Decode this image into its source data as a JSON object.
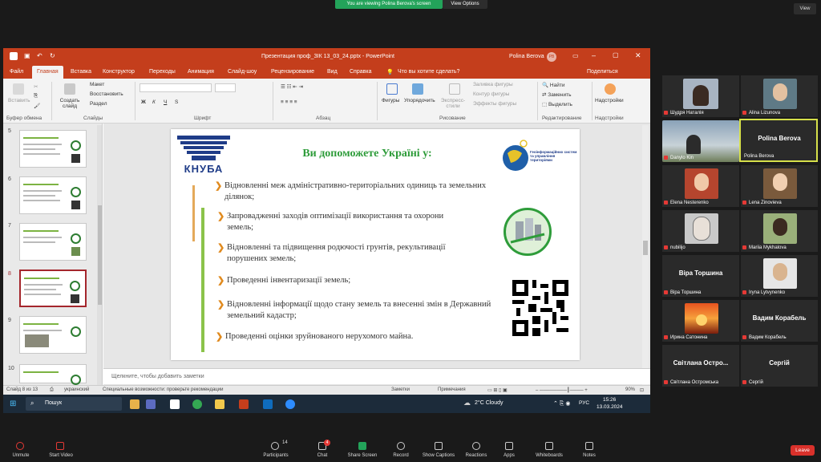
{
  "zoom": {
    "banner": "You are viewing Polina Berova's screen",
    "view_options": "View Options",
    "view": "View",
    "leave": "Leave",
    "participants_count": "14",
    "chat_badge": "4",
    "toolbar": [
      {
        "label": "Unmute",
        "icon": "mic-muted-icon"
      },
      {
        "label": "Start Video",
        "icon": "video-off-icon"
      },
      {
        "label": "Participants",
        "icon": "participants-icon"
      },
      {
        "label": "Chat",
        "icon": "chat-icon"
      },
      {
        "label": "Share Screen",
        "icon": "share-screen-icon"
      },
      {
        "label": "Record",
        "icon": "record-icon"
      },
      {
        "label": "Show Captions",
        "icon": "captions-icon"
      },
      {
        "label": "Reactions",
        "icon": "reactions-icon"
      },
      {
        "label": "Apps",
        "icon": "apps-icon"
      },
      {
        "label": "Whiteboards",
        "icon": "whiteboards-icon"
      },
      {
        "label": "Notes",
        "icon": "notes-icon"
      }
    ],
    "gallery": [
      {
        "name": "Шудря Наталія",
        "big": ""
      },
      {
        "name": "Alina Lizunova",
        "big": ""
      },
      {
        "name": "Danylo Kin",
        "big": ""
      },
      {
        "name": "Polina Berova",
        "big": "Polina Berova"
      },
      {
        "name": "Elena Nesterenko",
        "big": ""
      },
      {
        "name": "Lena Zinovieva",
        "big": ""
      },
      {
        "name": "nubilijo",
        "big": ""
      },
      {
        "name": "Mariia Mykhalova",
        "big": ""
      },
      {
        "name": "Віра Торшина",
        "big": "Віра Торшина"
      },
      {
        "name": "Iryna Lytvynenko",
        "big": ""
      },
      {
        "name": "Ирина Сатонина",
        "big": ""
      },
      {
        "name": "Вадим Корабель",
        "big": "Вадим Корабель"
      },
      {
        "name": "Світлана Остромська",
        "big": "Світлана  Остро..."
      },
      {
        "name": "Сергій",
        "big": "Сергій"
      }
    ]
  },
  "ppt": {
    "title": "Презентация проф_ЗІК 13_03_24.pptx  -  PowerPoint",
    "user": "Polina Berova",
    "user_initials": "PB",
    "tabs": [
      "Файл",
      "Главная",
      "Вставка",
      "Конструктор",
      "Переходы",
      "Анимация",
      "Слайд-шоу",
      "Рецензирование",
      "Вид",
      "Справка"
    ],
    "tell_me": "Что вы хотите сделать?",
    "share": "Поделиться",
    "ribbon": {
      "paste": "Вставить",
      "clipboard": "Буфер обмена",
      "new_slide": "Создать слайд",
      "layout": "Макет",
      "reset": "Восстановить",
      "section": "Раздел",
      "slides": "Слайды",
      "font": "Шрифт",
      "paragraph": "Абзац",
      "shapes": "Фигуры",
      "arrange": "Упорядочить",
      "quick_styles": "Экспресс-стили",
      "fill": "Заливка фигуры",
      "outline": "Контур фигуры",
      "effects": "Эффекты фигуры",
      "drawing": "Рисование",
      "find": "Найти",
      "replace": "Заменить",
      "select": "Выделить",
      "editing": "Редактирование",
      "addins": "Надстройки",
      "addins_group": "Надстройки"
    },
    "thumbnails": [
      "5",
      "6",
      "7",
      "8",
      "9",
      "10"
    ],
    "selected_slide": "8",
    "slide": {
      "logo_text": "КНУБА",
      "heading": "Ви допоможете Україні у:",
      "geo_text": "Геоінформаційних систем та управління територіями",
      "bullets": [
        "Відновленні меж адміністративно-територіальних одиниць та земельних ділянок;",
        "Запровадженні заходів оптимізації використання та охорони земель;",
        "Відновленні та підвищення родючості грунтів, рекультивації порушених земель;",
        "Проведенні інвентаризації земель;",
        "Відновленні інформації щодо стану земель та внесенні змін в Державний земельний кадастр;",
        "Проведенні оцінки зруйнованого нерухомого майна."
      ]
    },
    "notes_placeholder": "Щелкните, чтобы добавить заметки",
    "status": {
      "slide_count": "Слайд 8 из 13",
      "language": "украинский",
      "accessibility": "Специальные возможности: проверьте рекомендации",
      "notes": "Заметки",
      "comments": "Примечания",
      "zoom": "90%"
    }
  },
  "taskbar": {
    "search": "Пошук",
    "weather": "2°C  Cloudy",
    "lang": "РУС",
    "time": "15:26",
    "date": "13.03.2024"
  },
  "colors": {
    "ppt_accent": "#c43e1c",
    "zoom_green": "#23a35a",
    "leave": "#d9312b"
  }
}
